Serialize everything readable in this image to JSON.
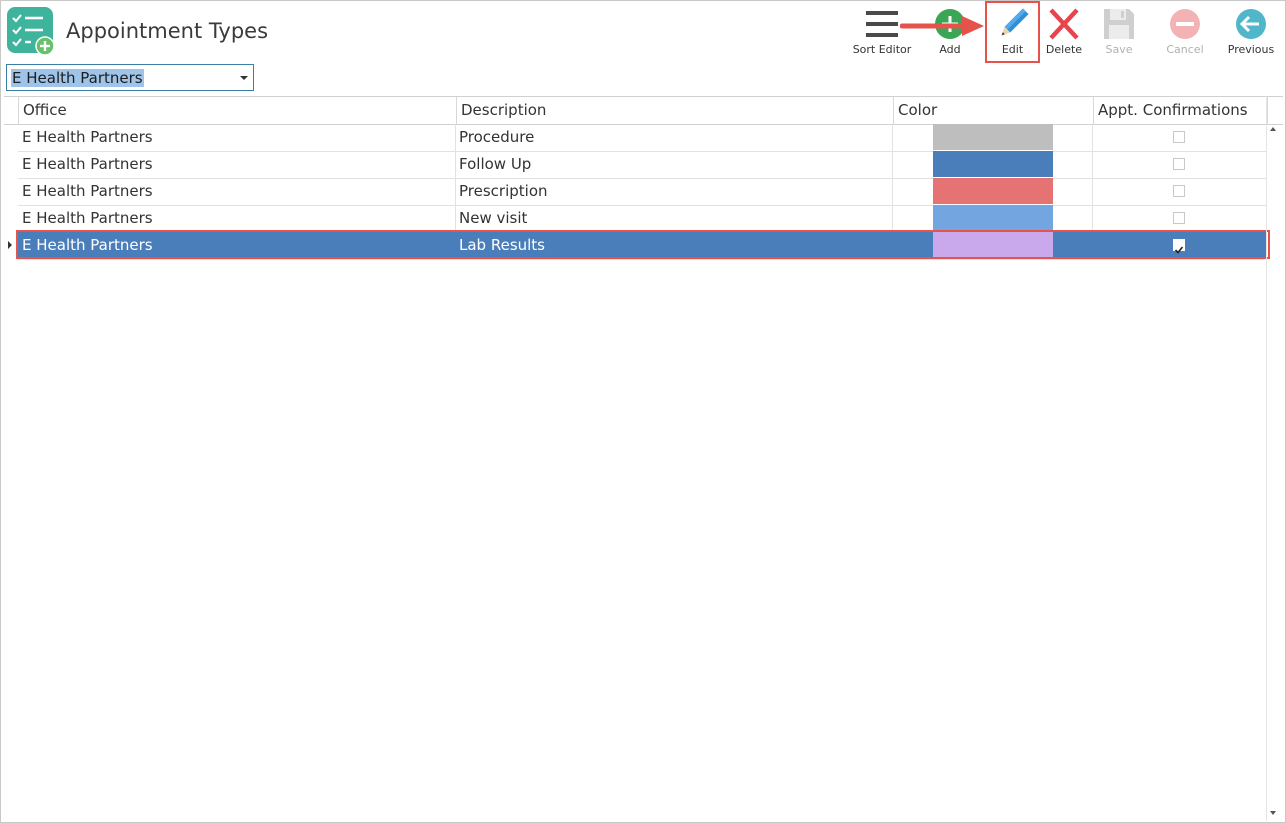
{
  "header": {
    "title": "Appointment Types",
    "app_icon": "checklist-add-icon"
  },
  "toolbar": {
    "items": [
      {
        "label": "Sort Editor",
        "icon": "hamburger-icon",
        "enabled": true
      },
      {
        "label": "Add",
        "icon": "add-circle-icon",
        "enabled": true
      },
      {
        "label": "Edit",
        "icon": "pencil-icon",
        "enabled": true
      },
      {
        "label": "Delete",
        "icon": "x-icon",
        "enabled": true
      },
      {
        "label": "Save",
        "icon": "floppy-icon",
        "enabled": false
      },
      {
        "label": "Cancel",
        "icon": "minus-circle-icon",
        "enabled": false
      },
      {
        "label": "Previous",
        "icon": "back-arrow-icon",
        "enabled": true
      }
    ]
  },
  "office_select": {
    "value": "E Health Partners"
  },
  "grid": {
    "columns": [
      "Office",
      "Description",
      "Color",
      "Appt. Confirmations"
    ],
    "rows": [
      {
        "office": "E Health Partners",
        "description": "Procedure",
        "color": "#bebebe",
        "confirm": false,
        "selected": false
      },
      {
        "office": "E Health Partners",
        "description": "Follow Up",
        "color": "#4a7ebb",
        "confirm": false,
        "selected": false
      },
      {
        "office": "E Health Partners",
        "description": "Prescription",
        "color": "#e57373",
        "confirm": false,
        "selected": false
      },
      {
        "office": "E Health Partners",
        "description": "New visit",
        "color": "#73a6e1",
        "confirm": false,
        "selected": false
      },
      {
        "office": "E Health Partners",
        "description": "Lab Results",
        "color": "#c9a9ec",
        "confirm": true,
        "selected": true
      }
    ]
  },
  "colors": {
    "accent_red": "#e5534b",
    "selection_blue": "#4a7ebb"
  }
}
